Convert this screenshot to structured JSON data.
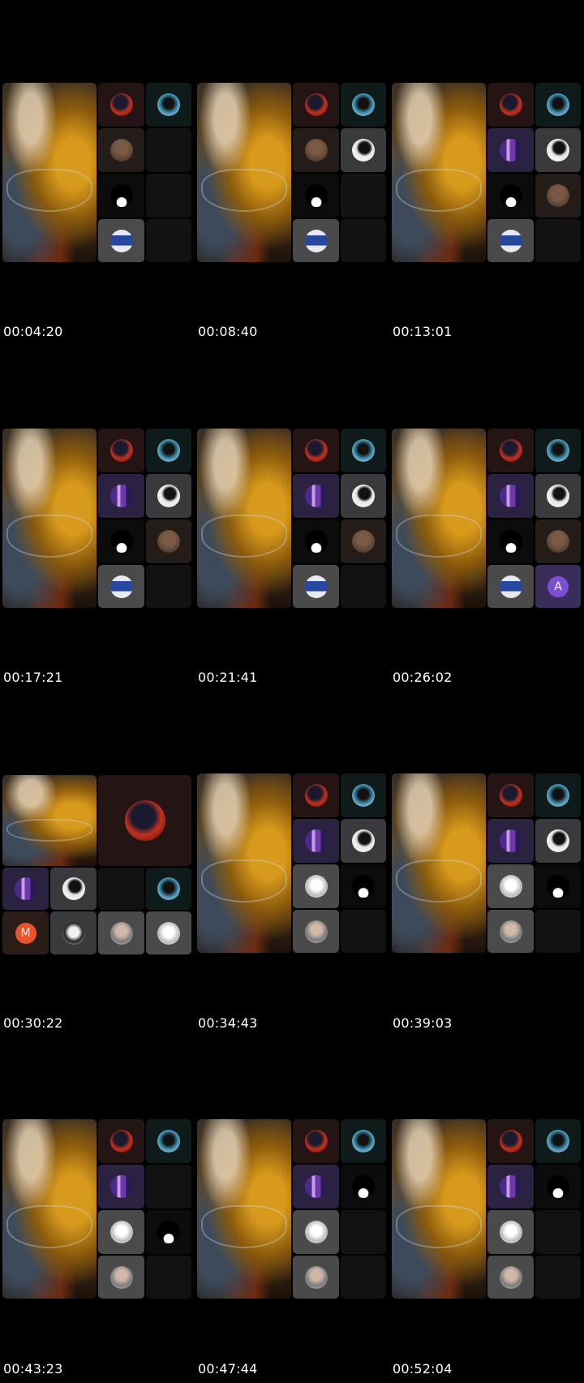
{
  "timestamps": [
    "00:04:20",
    "00:08:40",
    "00:13:01",
    "00:17:21",
    "00:21:41",
    "00:26:02",
    "00:30:22",
    "00:34:43",
    "00:39:03",
    "00:43:23",
    "00:47:44",
    "00:52:04"
  ],
  "participants": {
    "A_label": "A",
    "M_label": "M"
  },
  "colors": {
    "background": "#000000",
    "timestamp_text": "#ffffff",
    "avatar_purple": "#7b4fd0",
    "avatar_orange": "#e9532a"
  }
}
